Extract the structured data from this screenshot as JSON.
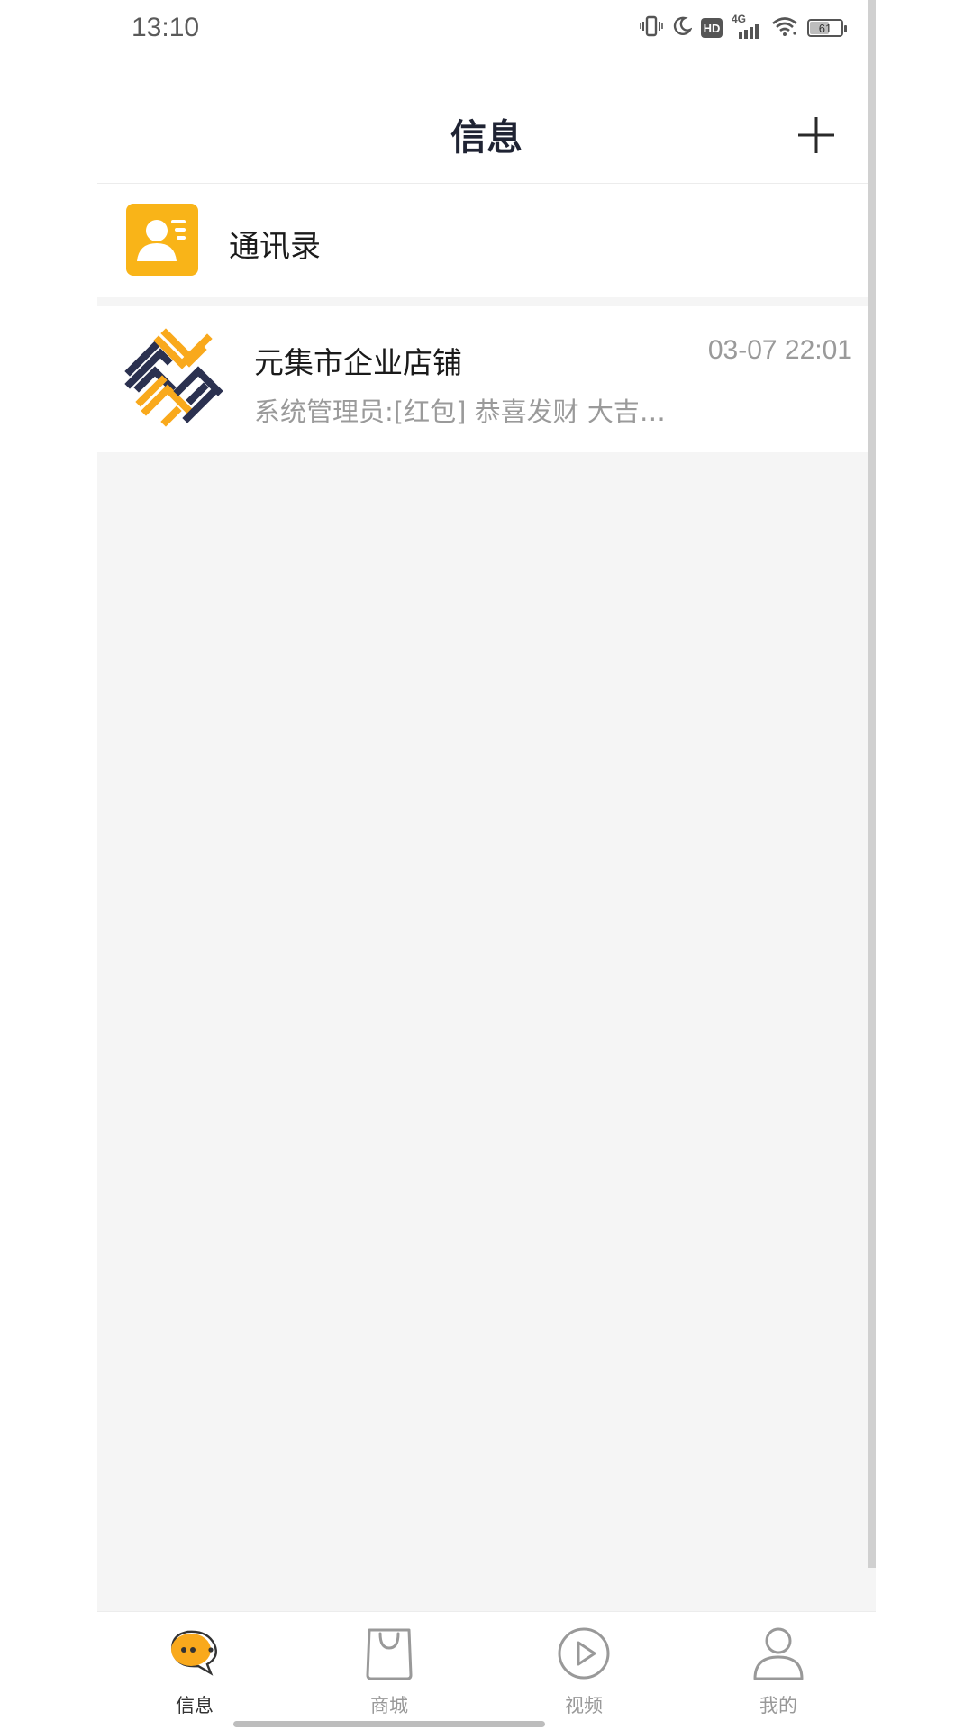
{
  "status_bar": {
    "time": "13:10",
    "battery_level": "61",
    "icons": [
      "vibrate-icon",
      "moon-icon",
      "hd-icon",
      "signal-4g-icon",
      "wifi-icon",
      "battery-icon"
    ],
    "hd_label": "HD",
    "network_label": "4G"
  },
  "header": {
    "title": "信息",
    "add_icon": "plus-icon"
  },
  "contacts": {
    "label": "通讯录",
    "icon": "contact-card-icon",
    "icon_color": "#f9b418"
  },
  "conversations": [
    {
      "name": "元集市企业店铺",
      "time": "03-07 22:01",
      "preview": "系统管理员:[红包] 恭喜发财 大吉…",
      "avatar": "shop-logo-icon"
    }
  ],
  "bottom_nav": {
    "items": [
      {
        "label": "信息",
        "icon": "chat-bubble-icon",
        "active": true
      },
      {
        "label": "商城",
        "icon": "shopping-bag-icon",
        "active": false
      },
      {
        "label": "视频",
        "icon": "play-circle-icon",
        "active": false
      },
      {
        "label": "我的",
        "icon": "user-icon",
        "active": false
      }
    ]
  },
  "colors": {
    "accent": "#f9a91c",
    "logo_dark": "#2b3150",
    "background": "#f5f5f5",
    "muted_text": "#9a9a9a"
  }
}
